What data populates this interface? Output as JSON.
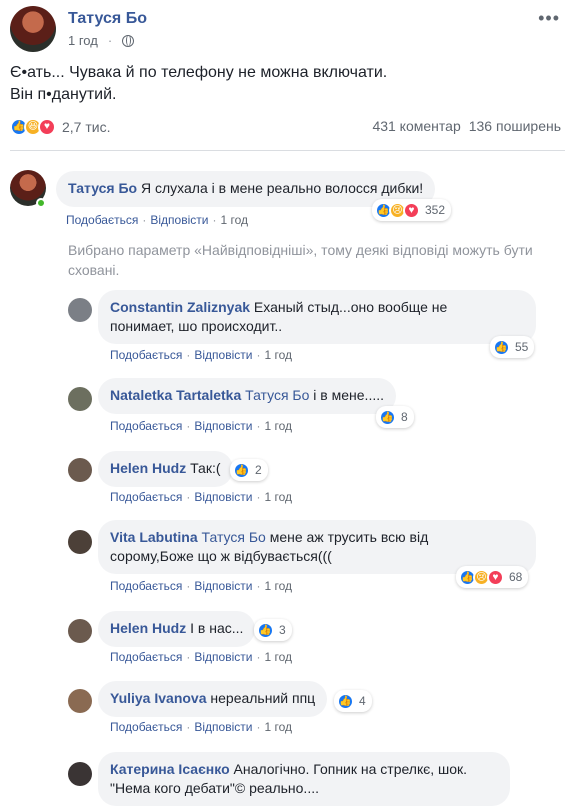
{
  "post": {
    "author": "Татуся Бо",
    "time": "1 год",
    "text_line1": "Є•ать... Чувака й по телефону не можна включати.",
    "text_line2": "Він п•данутий.",
    "reaction_count": "2,7 тис.",
    "comments_count": "431 коментар",
    "shares_count": "136 поширень"
  },
  "labels": {
    "like": "Подобається",
    "reply": "Відповісти"
  },
  "notice": "Вибрано параметр «Найвідповідніші», тому деякі відповіді можуть бути сховані.",
  "comments": [
    {
      "name": "Татуся Бо",
      "text": "Я слухала і в мене реально волосся дибки!",
      "time": "1 год",
      "reactions": "352"
    },
    {
      "name": "Constantin Zaliznyak",
      "text_line1": "Еханый стыд...оно вообще не",
      "text_line2": "понимает, шо происходит..",
      "time": "1 год",
      "reactions": "55"
    },
    {
      "name": "Nataletka Tartaletka",
      "mention": "Татуся Бо",
      "text": "і в мене.....",
      "time": "1 год",
      "reactions": "8"
    },
    {
      "name": "Helen Hudz",
      "text": "Так:(",
      "time": "1 год",
      "reactions": "2"
    },
    {
      "name": "Vita Labutina",
      "mention": "Татуся Бо",
      "text_line1": "мене аж трусить всю від",
      "text_line2": "сорому,Боже що ж відбувається(((",
      "time": "1 год",
      "reactions": "68"
    },
    {
      "name": "Helen Hudz",
      "text": "І в нас...",
      "time": "1 год",
      "reactions": "3"
    },
    {
      "name": "Yuliya Ivanova",
      "text": "нереальний ппц",
      "time": "1 год",
      "reactions": "4"
    },
    {
      "name": "Катерина Ісаєнко",
      "text_line1": "Аналогічно. Гопник на стрелкє, шок.",
      "text_line2": "\"Нема кого дебати\"© реально...."
    }
  ],
  "colors": {
    "link": "#385898",
    "like": "#1877f2",
    "haha": "#f7b125",
    "love": "#f33e58",
    "bubble": "#f2f3f5"
  }
}
